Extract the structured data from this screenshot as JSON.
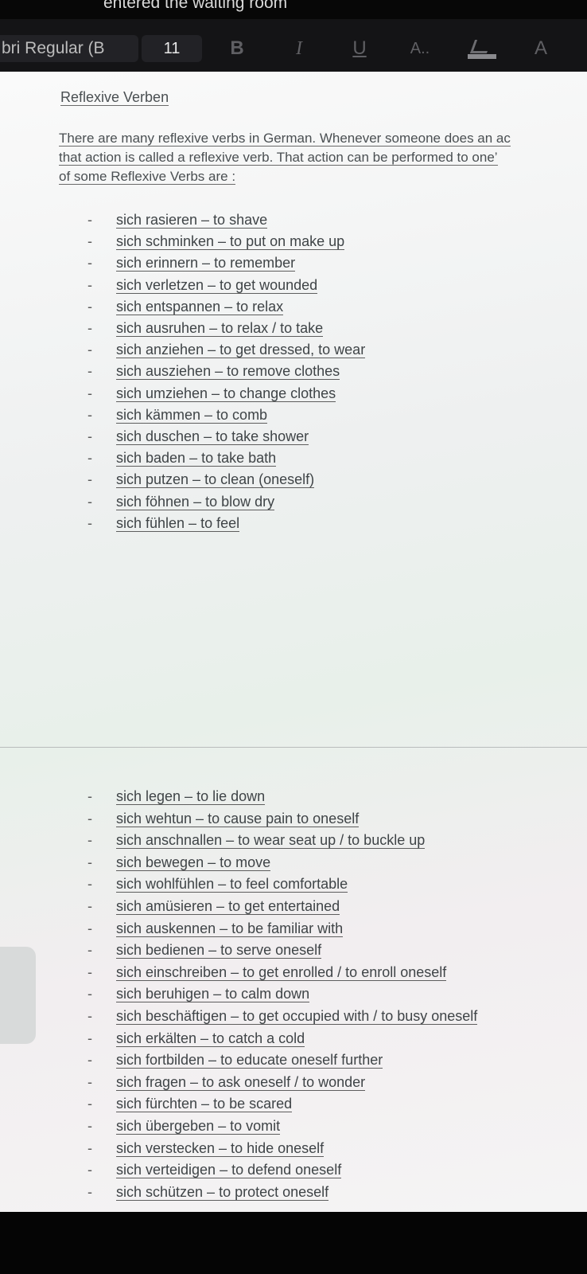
{
  "notification": "entered the waiting room",
  "toolbar": {
    "font_name": "bri Regular (B",
    "font_size": "11",
    "bold_label": "B",
    "italic_label": "I",
    "underline_label": "U",
    "font_color_label": "A..",
    "clear_label": "A"
  },
  "document": {
    "title": "Reflexive Verben",
    "intro": [
      "There are many reflexive verbs in German. Whenever someone does an ac",
      "that action is called a reflexive verb. That action can be performed to one’",
      "of some Reflexive Verbs are :"
    ],
    "dash": "-",
    "verbs_group1": [
      "sich rasieren – to shave",
      "sich schminken – to put on make up",
      "sich erinnern – to remember",
      "sich verletzen – to get wounded",
      "sich entspannen – to relax",
      "sich ausruhen – to relax / to take",
      "sich anziehen – to get dressed, to wear",
      "sich ausziehen – to remove clothes",
      "sich umziehen – to change clothes",
      "sich kämmen – to comb",
      "sich duschen – to take shower",
      "sich baden – to take bath",
      "sich putzen – to clean (oneself)",
      "sich föhnen – to blow dry",
      "sich fühlen – to feel"
    ],
    "verbs_group2": [
      "sich legen – to lie down",
      "sich wehtun – to cause pain to oneself",
      "sich anschnallen – to wear seat up / to buckle up",
      "sich bewegen – to move",
      "sich wohlfühlen – to feel comfortable",
      "sich amüsieren – to get entertained",
      "sich auskennen – to be familiar with",
      "sich bedienen – to serve oneself",
      "sich einschreiben – to get enrolled / to enroll oneself",
      "sich beruhigen – to calm down",
      "sich beschäftigen – to get occupied with / to busy oneself",
      "sich erkälten – to catch a cold",
      "sich fortbilden – to educate oneself further",
      "sich fragen – to ask oneself / to wonder",
      "sich fürchten – to be scared",
      "sich übergeben – to vomit",
      "sich verstecken – to hide oneself",
      "sich verteidigen – to defend oneself",
      "sich schützen – to protect oneself"
    ]
  }
}
